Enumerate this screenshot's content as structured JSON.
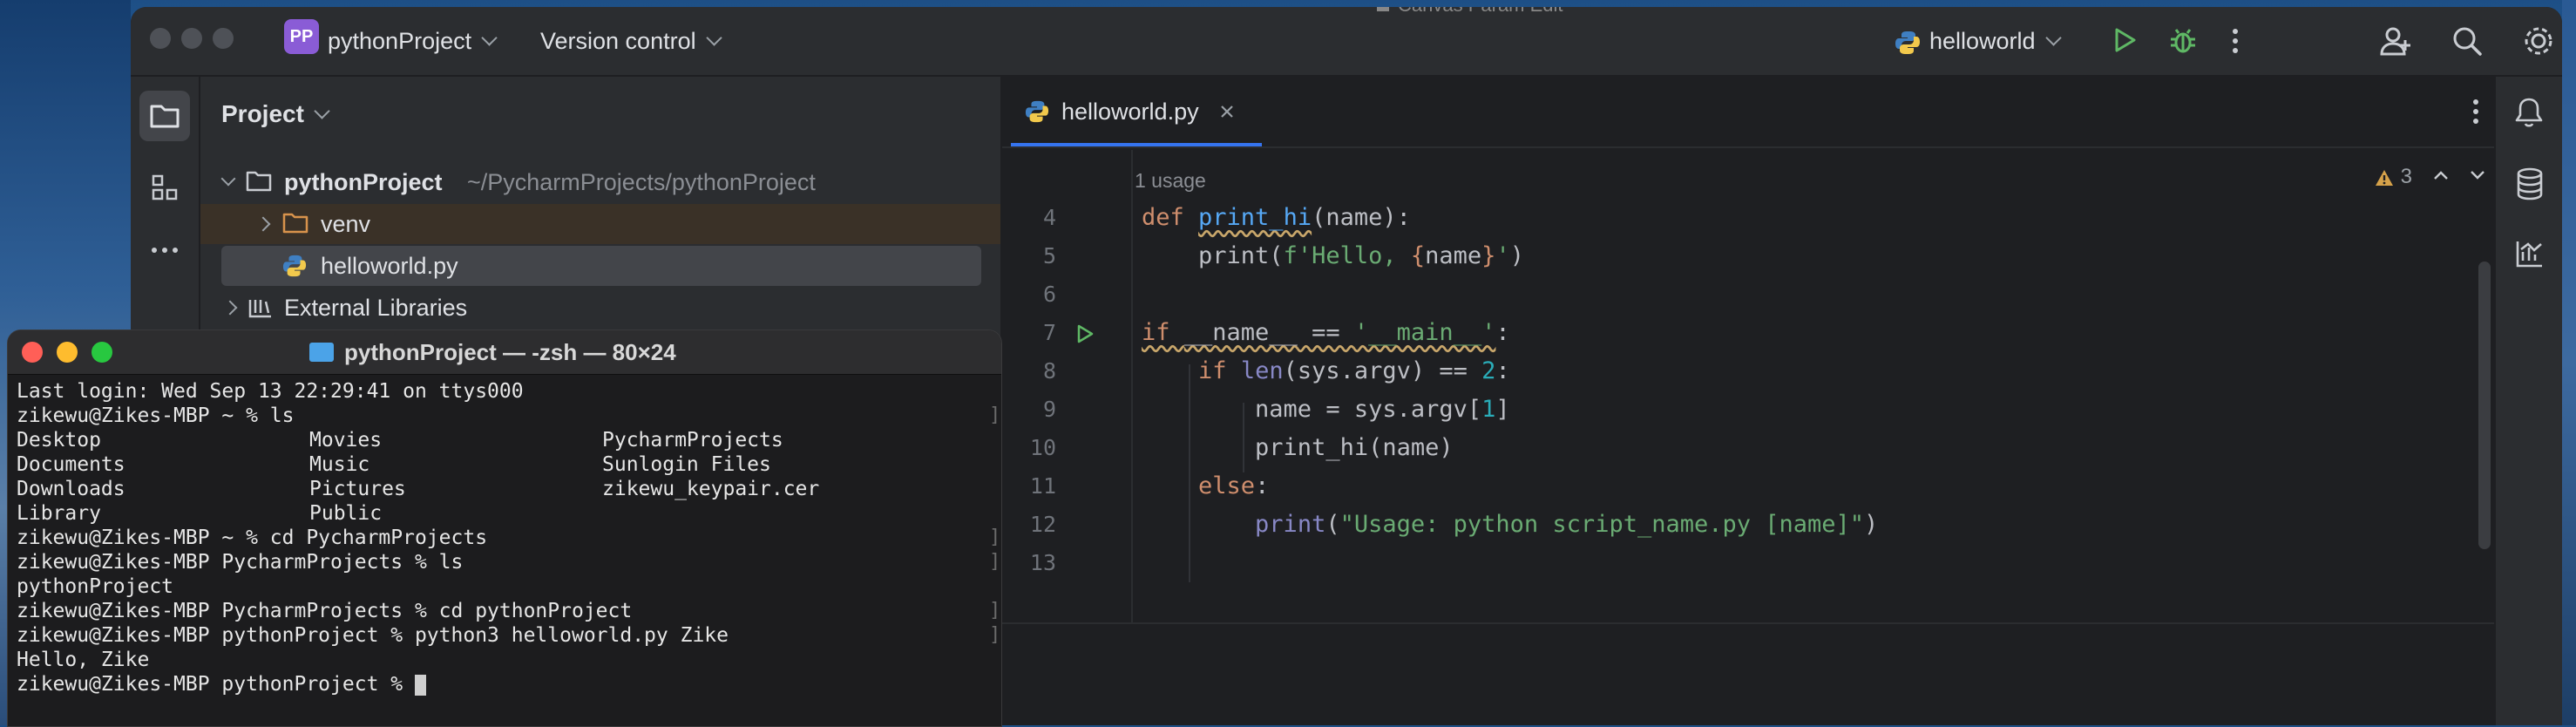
{
  "ide": {
    "project_badge": "PP",
    "project_name": "pythonProject",
    "version_control": "Version control",
    "top_file_title": "Canvas Param Edit",
    "run_config": "helloworld",
    "project_panel_title": "Project",
    "tree": [
      {
        "label": "pythonProject",
        "path": "~/PycharmProjects/pythonProject"
      },
      {
        "label": "venv"
      },
      {
        "label": "helloworld.py"
      },
      {
        "label": "External Libraries"
      }
    ],
    "editor_tab": "helloworld.py",
    "usage_hint": "1 usage",
    "warning_count": "3",
    "line_numbers": [
      "4",
      "5",
      "6",
      "7",
      "8",
      "9",
      "10",
      "11",
      "12",
      "13"
    ],
    "code": {
      "l4_kw": "def ",
      "l4_fn": "print_hi",
      "l4_rest": "(name):",
      "l5_pre": "    print(",
      "l5_str1": "f'Hello, ",
      "l5_brace1": "{",
      "l5_name": "name",
      "l5_brace2": "}",
      "l5_str2": "'",
      "l5_end": ")",
      "l7_kw": "if ",
      "l7_dd": "__name__",
      "l7_mid": " == ",
      "l7_str": "'__main__'",
      "l7_end": ":",
      "l8_pre": "    ",
      "l8_kw": "if ",
      "l8_bi": "len",
      "l8_mid": "(sys.argv) == ",
      "l8_num": "2",
      "l8_end": ":",
      "l9_pre": "        name = sys.argv[",
      "l9_num": "1",
      "l9_end": "]",
      "l10": "        print_hi(name)",
      "l11_pre": "    ",
      "l11_kw": "else",
      "l11_end": ":",
      "l12_pre": "        ",
      "l12_bi": "print",
      "l12_open": "(",
      "l12_str": "\"Usage: python script_name.py [name]\"",
      "l12_end": ")"
    }
  },
  "terminal": {
    "title": "pythonProject — -zsh — 80×24",
    "lines": [
      "Last login: Wed Sep 13 22:29:41 on ttys000",
      "zikewu@Zikes-MBP ~ % ls"
    ],
    "ls_columns": [
      [
        "Desktop",
        "Documents",
        "Downloads",
        "Library"
      ],
      [
        "Movies",
        "Music",
        "Pictures",
        "Public"
      ],
      [
        "PycharmProjects",
        "Sunlogin Files",
        "zikewu_keypair.cer",
        ""
      ]
    ],
    "lines_after": [
      "zikewu@Zikes-MBP ~ % cd PycharmProjects",
      "zikewu@Zikes-MBP PycharmProjects % ls",
      "pythonProject",
      "zikewu@Zikes-MBP PycharmProjects % cd pythonProject",
      "zikewu@Zikes-MBP pythonProject % python3 helloworld.py Zike",
      "Hello, Zike",
      "zikewu@Zikes-MBP pythonProject % "
    ]
  }
}
